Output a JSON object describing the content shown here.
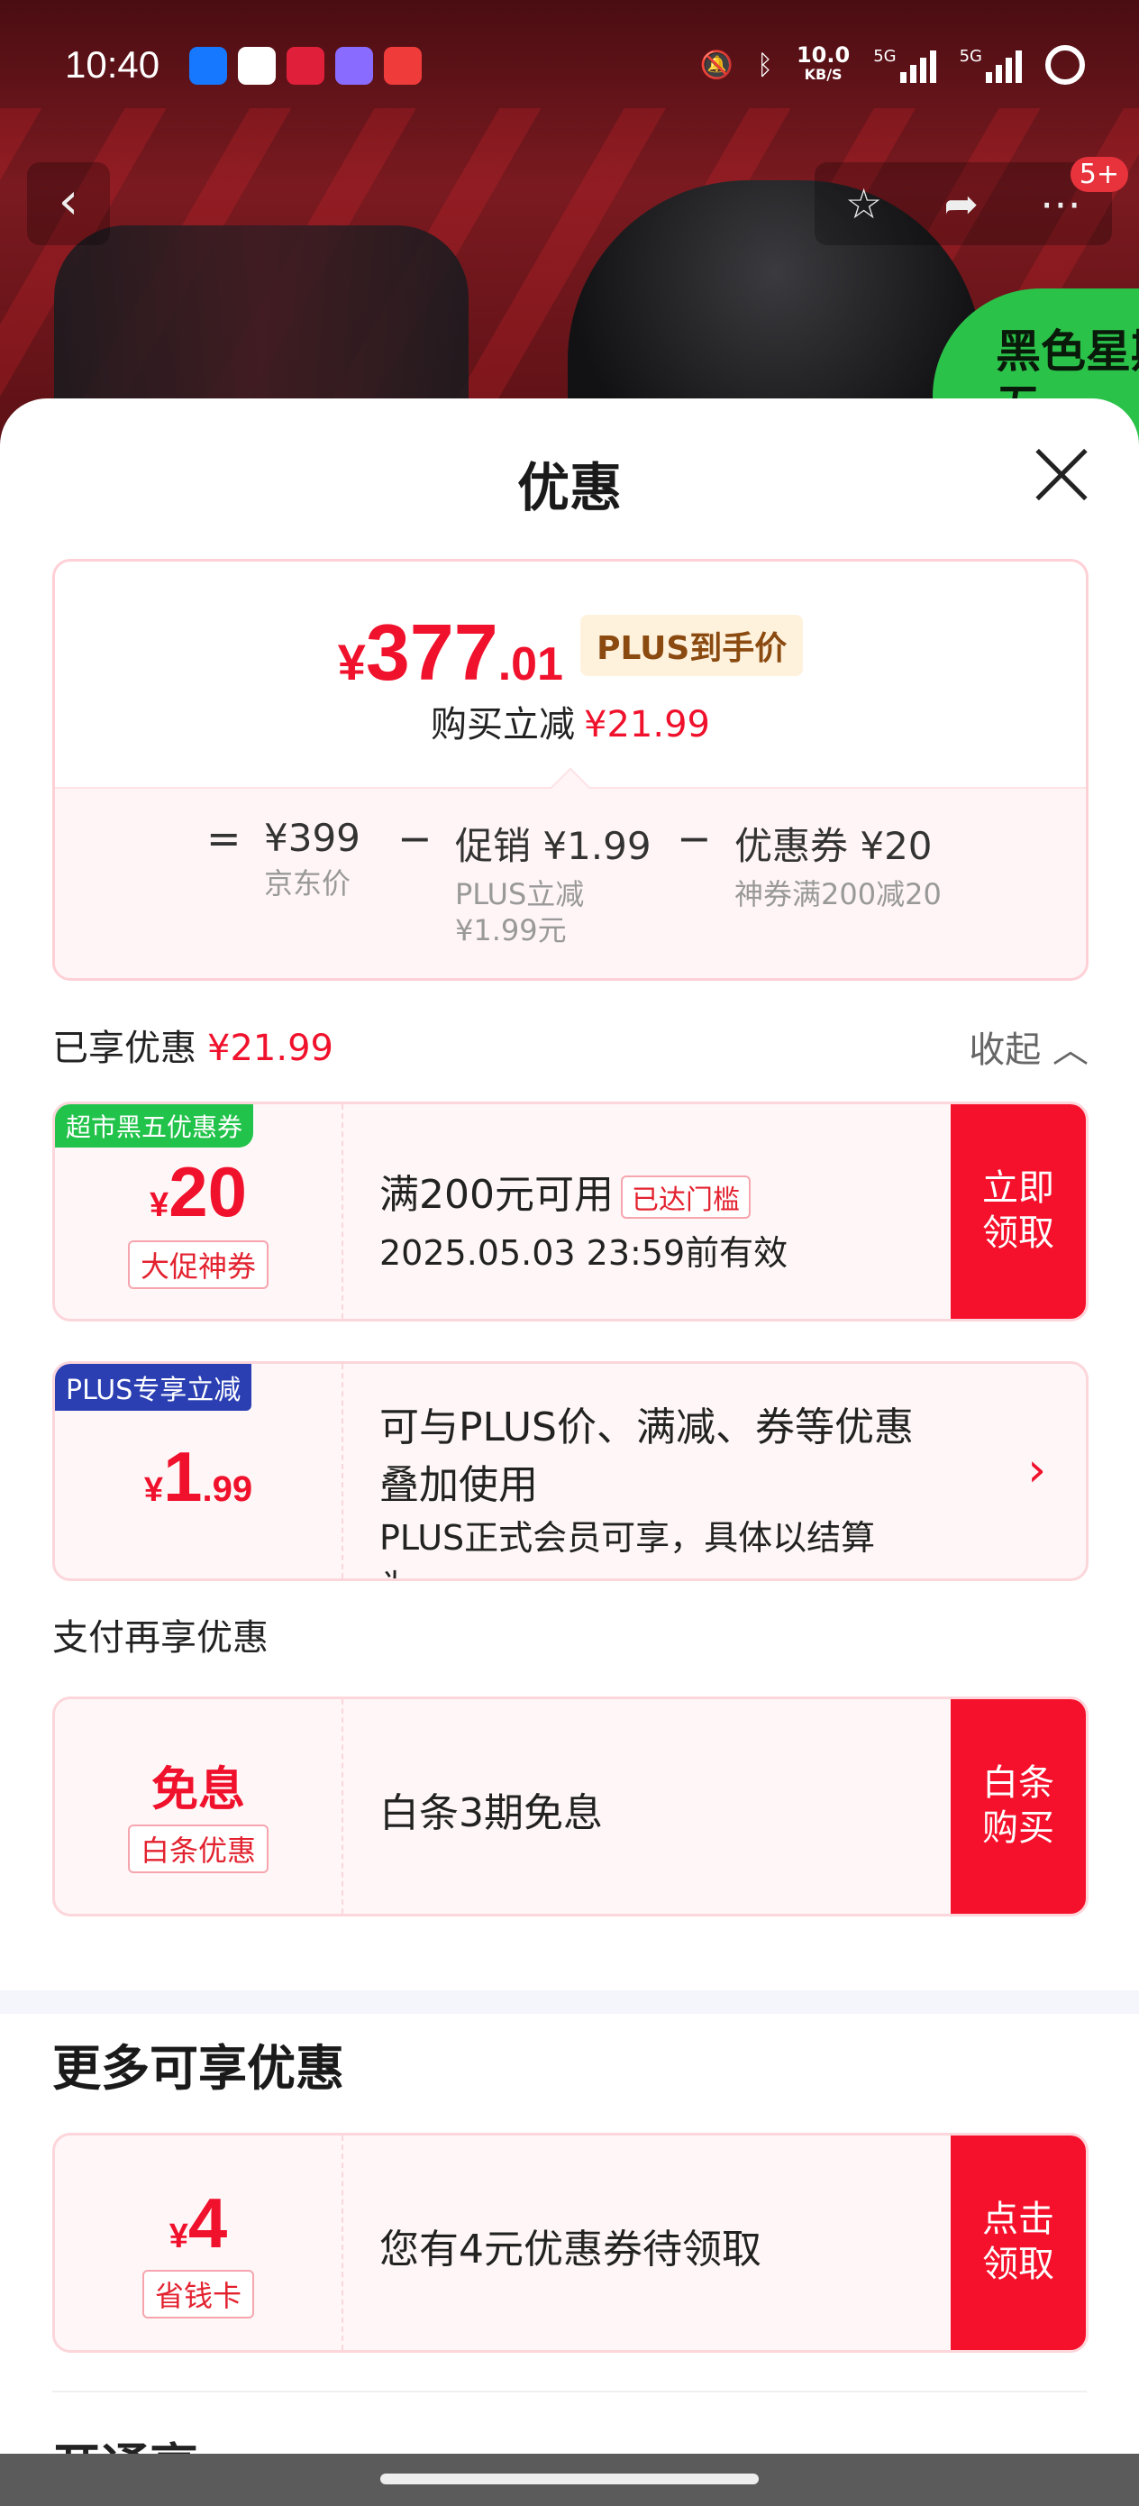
{
  "status_bar": {
    "time": "10:40",
    "net_speed_value": "10.0",
    "net_speed_unit": "KB/S",
    "signal1": "5G",
    "signal2": "5G"
  },
  "top_nav": {
    "badge": "5+",
    "promo_text": "黑色星期五"
  },
  "sheet": {
    "title": "优惠"
  },
  "price": {
    "currency": "¥",
    "main_int": "377",
    "main_dec": ".01",
    "tag": "PLUS到手价",
    "sub_label": "购买立减",
    "sub_value": "¥21.99",
    "formula": {
      "eq": "=",
      "op1": "−",
      "op2": "−",
      "item1_value": "¥399",
      "item1_desc": "京东价",
      "item2_value": "促销 ¥1.99",
      "item2_desc_line1": "PLUS立减",
      "item2_desc_line2": "¥1.99元",
      "item3_value": "优惠券 ¥20",
      "item3_desc": "神券满200减20"
    }
  },
  "enjoyed": {
    "label": "已享优惠",
    "value": "¥21.99",
    "collapse": "收起"
  },
  "cards": [
    {
      "corner": "超市黑五优惠券",
      "currency": "¥",
      "amount": "20",
      "sub_tag": "大促神券",
      "title": "满200元可用",
      "reached": "已达门槛",
      "desc": "2025.05.03 23:59前有效",
      "action_line1": "立即",
      "action_line2": "领取"
    },
    {
      "corner": "PLUS专享立减",
      "currency": "¥",
      "amount": "1",
      "amount_dec": ".99",
      "title_line1": "可与PLUS价、满减、券等优惠",
      "title_line2": "叠加使用",
      "desc": "PLUS正式会员可享，具体以结算为..."
    }
  ],
  "payment": {
    "label": "支付再享优惠",
    "card": {
      "main": "免息",
      "sub_tag": "白条优惠",
      "title": "白条3期免息",
      "action_line1": "白条",
      "action_line2": "购买"
    }
  },
  "more": {
    "title": "更多可享优惠",
    "card": {
      "currency": "¥",
      "amount": "4",
      "sub_tag": "省钱卡",
      "title": "您有4元优惠券待领取",
      "action_line1": "点击",
      "action_line2": "领取"
    },
    "next_section": "开通享"
  },
  "colors": {
    "accent_red": "#f5112b",
    "price_red": "#f0112c",
    "plus_blue": "#2b3fb3",
    "coupon_green": "#22c34a",
    "tag_gold_bg": "#fff2dd"
  }
}
